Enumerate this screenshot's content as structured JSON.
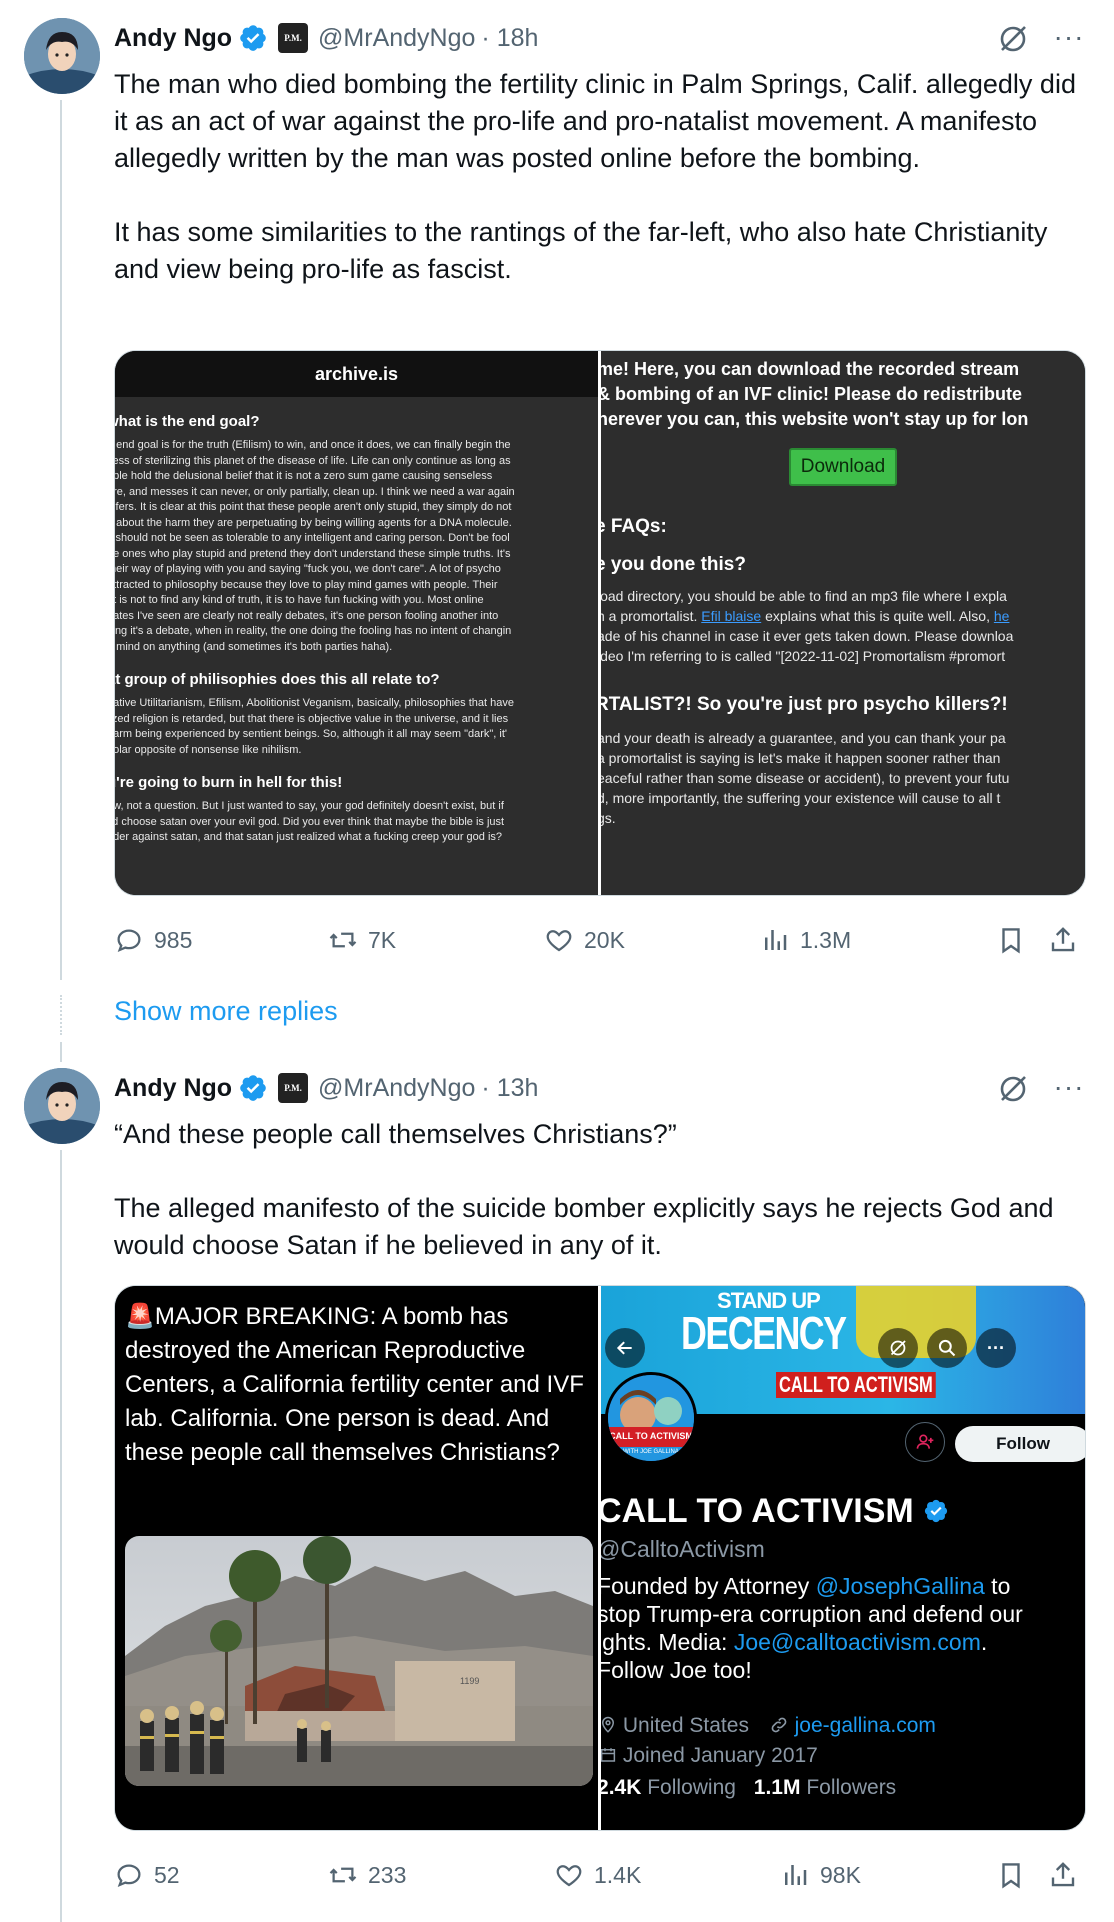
{
  "posts": [
    {
      "author_name": "Andy Ngo",
      "handle": "@MrAndyNgo",
      "time": "· 18h",
      "badge_text": "P.M.",
      "paragraphs": [
        "The man who died bombing the fertility clinic in Palm Springs, Calif. allegedly did it as an act of war against the pro-life and pro-natalist movement. A manifesto allegedly written by the man was posted online before the bombing.",
        "It has some similarities to the rantings of the far-left, who also hate Christianity and view being pro-life as fascist."
      ],
      "stats": {
        "replies": "985",
        "reposts": "7K",
        "likes": "20K",
        "views": "1.3M"
      }
    },
    {
      "author_name": "Andy Ngo",
      "handle": "@MrAndyNgo",
      "time": "· 13h",
      "badge_text": "P.M.",
      "paragraphs": [
        "“And these people call themselves Christians?”",
        "The alleged manifesto of the suicide bomber explicitly says he rejects God and would choose Satan if he believed in any of it."
      ],
      "stats": {
        "replies": "52",
        "reposts": "233",
        "likes": "1.4K",
        "views": "98K"
      }
    }
  ],
  "show_more_replies": "Show more replies",
  "archive_left": {
    "site": "archive.is",
    "q1": "what is the end goal?",
    "p1": [
      "e end goal is for the truth (Efilism) to win, and once it does, we can finally begin the",
      "cess of sterilizing this planet of the disease of life. Life can only continue as long as",
      "ople hold the delusional belief that it is not a zero sum game causing senseless",
      "ure, and messes it can never, or only partially, clean up. I think we need a war again",
      "-lifers. It is clear at this point that these people aren't only stupid, they simply do not",
      "e about the harm they are perpetuating by being willing agents for a DNA molecule.",
      "s should not be seen as tolerable to any intelligent and caring person. Don't be fool",
      "he ones who play stupid and pretend they don't understand these simple truths. It's",
      " their way of playing with you and saying \"fuck you, we don't care\". A lot of psycho",
      " attracted to philosophy because they love to play mind games with people. Their",
      "nt is not to find any kind of truth, it is to have fun fucking with you. Most online",
      "oates I've seen are clearly not really debates, it's one person fooling another into",
      "king it's a debate, when in reality, the one doing the fooling has no intent of changin",
      "ir mind on anything (and sometimes it's both parties haha)."
    ],
    "q2": "at group of philisophies does this all relate to?",
    "p2": [
      "gative Utilitarianism, Efilism, Abolitionist Veganism, basically, philosophies that have",
      "lized religion is retarded, but that there is objective value in the universe, and it lies",
      " harm being experienced by sentient beings. So, although it all may seem \"dark\", it'",
      " polar opposite of nonsense like nihilism."
    ],
    "q3": "u're going to burn in hell for this!",
    "p3": [
      "ow, not a question. But I just wanted to say, your god definitely doesn't exist, but if",
      " I'd choose satan over your evil god. Did you ever think that maybe the bible is just",
      "nder against satan, and that satan just realized what a fucking creep your god is?"
    ]
  },
  "archive_right": {
    "intro": [
      "me! Here, you can download the recorded stream",
      "& bombing of an IVF clinic! Please do redistribute",
      "herever you can, this website won't stay up for lon"
    ],
    "download": "Download",
    "faqs": "e FAQs:",
    "q1": "e you done this?",
    "p1_a": "load directory, you should be able to find an mp3 file where I expla",
    "p1_b_pre": "n a promortalist. ",
    "p1_link1": "Efil blaise",
    "p1_b_mid": " explains what this is quite well. Also, ",
    "p1_link2": "he",
    "p1_c": "ade of his channel in case it ever gets taken down. Please downloa",
    "p1_d": "ideo I'm referring to is called \"[2022-11-02] Promortalism #promort",
    "q2": "RTALIST?! So you're just pro psycho killers?!",
    "p2": [
      "and your death is already a guarantee, and you can thank your pa",
      " a promortalist is saying is let's make it happen sooner rather than",
      "eaceful rather than some disease or accident), to prevent your futu",
      "d, more importantly, the suffering your existence will cause to all t",
      "gs."
    ]
  },
  "breaking": {
    "emoji": "🚨",
    "text": "MAJOR BREAKING: A bomb has destroyed the American Reproductive Centers, a California fertility center and IVF lab.  California. One person is dead. And these people call themselves Christians?",
    "building_number": "1199"
  },
  "profile": {
    "banner_line1": "STAND UP",
    "banner_line2": "DECENCY",
    "banner_line3": "CALL TO ACTIVISM",
    "avatar_text": "CALL TO ACTIVISM",
    "avatar_sub": "WITH JOE GALLINA",
    "follow": "Follow",
    "name": "CALL TO ACTIVISM",
    "handle": "@CalltoActivism",
    "bio_1a": "Founded by Attorney ",
    "bio_1b": "@JosephGallina",
    "bio_1c": " to",
    "bio_2": "stop Trump-era corruption and defend our",
    "bio_3a": "ights. Media: ",
    "bio_3b": "Joe@calltoactivism.com",
    "bio_3c": ".",
    "bio_4": "Follow Joe too!",
    "location": "United States",
    "website": "joe-gallina.com",
    "joined": "Joined January 2017",
    "following_count": "2.4K",
    "following_label": "Following",
    "followers_count": "1.1M",
    "followers_label": "Followers"
  },
  "colors": {
    "accent": "#1d9bf0",
    "muted": "#536471",
    "thread": "#cfd9de"
  }
}
